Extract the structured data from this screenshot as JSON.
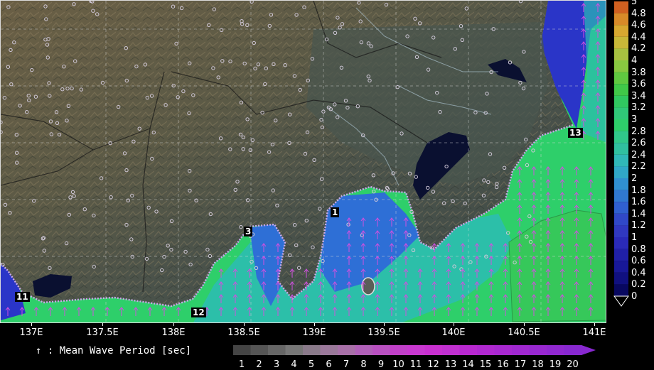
{
  "map": {
    "x_axis": {
      "ticks": [
        "137E",
        "137.5E",
        "138E",
        "138.5E",
        "139E",
        "139.5E",
        "140E",
        "140.5E",
        "141E"
      ]
    },
    "station_markers": [
      "1",
      "3",
      "11",
      "12",
      "13"
    ],
    "colors": {
      "land_dark": "#3f4a45",
      "land_mid": "#5a6150",
      "land_light": "#7b6f52",
      "sea_green": "#2ecf6a",
      "sea_cyan": "#2bbcb4",
      "sea_blue": "#2e6fd6",
      "sea_deep_blue": "#2a35c8",
      "arrow": "#d050e0"
    }
  },
  "colorbar": {
    "labels": [
      "5",
      "4.8",
      "4.6",
      "4.4",
      "4.2",
      "4",
      "3.8",
      "3.6",
      "3.4",
      "3.2",
      "3",
      "2.8",
      "2.6",
      "2.4",
      "2.2",
      "2",
      "1.8",
      "1.6",
      "1.4",
      "1.2",
      "1",
      "0.8",
      "0.6",
      "0.4",
      "0.2",
      "0"
    ],
    "colors": [
      "#d06020",
      "#d88a28",
      "#d8a830",
      "#c8b838",
      "#a8c040",
      "#88c840",
      "#60c840",
      "#40c848",
      "#30c860",
      "#30c878",
      "#2ecf6a",
      "#30c88a",
      "#30c0a0",
      "#30b8b8",
      "#30a8c8",
      "#3090d0",
      "#3078d0",
      "#3060d0",
      "#3048c8",
      "#3038c0",
      "#2a2ab8",
      "#2020a8",
      "#181898",
      "#101080",
      "#080860"
    ]
  },
  "legend": {
    "title": "↑ : Mean Wave Period [sec]",
    "scale_labels": [
      "1",
      "2",
      "3",
      "4",
      "5",
      "6",
      "7",
      "8",
      "9",
      "10",
      "11",
      "12",
      "13",
      "14",
      "15",
      "16",
      "17",
      "18",
      "19",
      "20"
    ],
    "scale_colors": [
      "#444444",
      "#555555",
      "#666666",
      "#777777",
      "#8a7a8a",
      "#9a789a",
      "#a870a8",
      "#b060b8",
      "#b850c0",
      "#c040c8",
      "#c838d0",
      "#c830d0",
      "#c030d0",
      "#b828d0",
      "#b028d0",
      "#a828d0",
      "#a028d0",
      "#9828d0",
      "#9028d0",
      "#8828d0"
    ]
  }
}
